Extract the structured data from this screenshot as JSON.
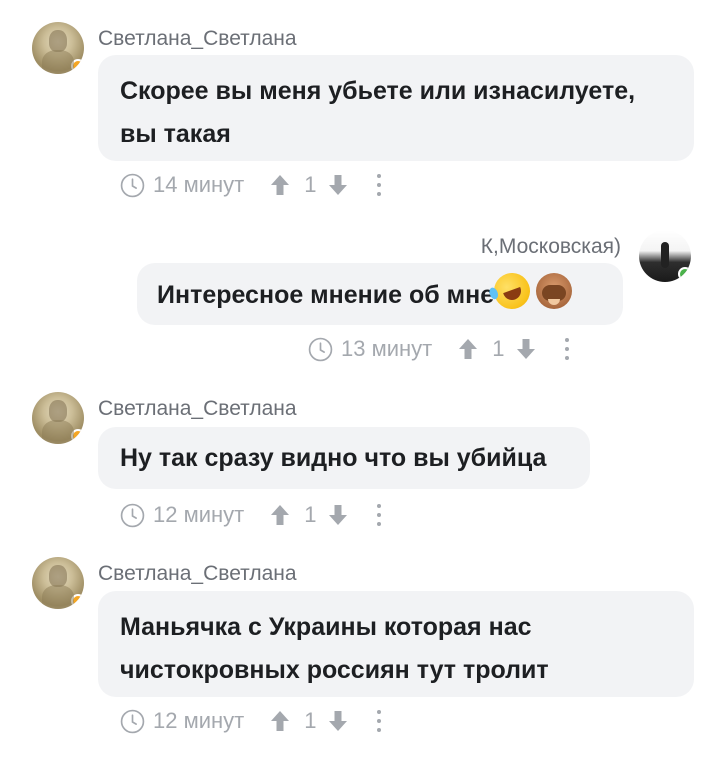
{
  "comments": [
    {
      "author": "Светлана_Светлана",
      "text": "Скорее вы меня убьете или изнасилуете, вы такая",
      "time": "14 минут",
      "votes": "1",
      "status_color": "#f5a623"
    },
    {
      "author": "К,Московская)",
      "text": "Интересное мнение об мне",
      "emojis": [
        "rolling-on-floor-laughing-emoji",
        "see-no-evil-monkey-emoji"
      ],
      "time": "13 минут",
      "votes": "1",
      "status_color": "#4bb34b"
    },
    {
      "author": "Светлана_Светлана",
      "text": "Ну так сразу видно что вы убийца",
      "time": "12 минут",
      "votes": "1",
      "status_color": "#f5a623"
    },
    {
      "author": "Светлана_Светлана",
      "text": "Маньячка с Украины которая нас чистокровных россиян тут тролит",
      "time": "12 минут",
      "votes": "1",
      "status_color": "#f5a623"
    }
  ],
  "colors": {
    "bubble_bg": "#f2f3f5",
    "author_text": "#6b6f76",
    "meta_text": "#a4a8ae",
    "message_text": "#1d1f22"
  },
  "icons": [
    "clock-icon",
    "upvote-arrow-icon",
    "downvote-arrow-icon",
    "more-options-icon"
  ]
}
